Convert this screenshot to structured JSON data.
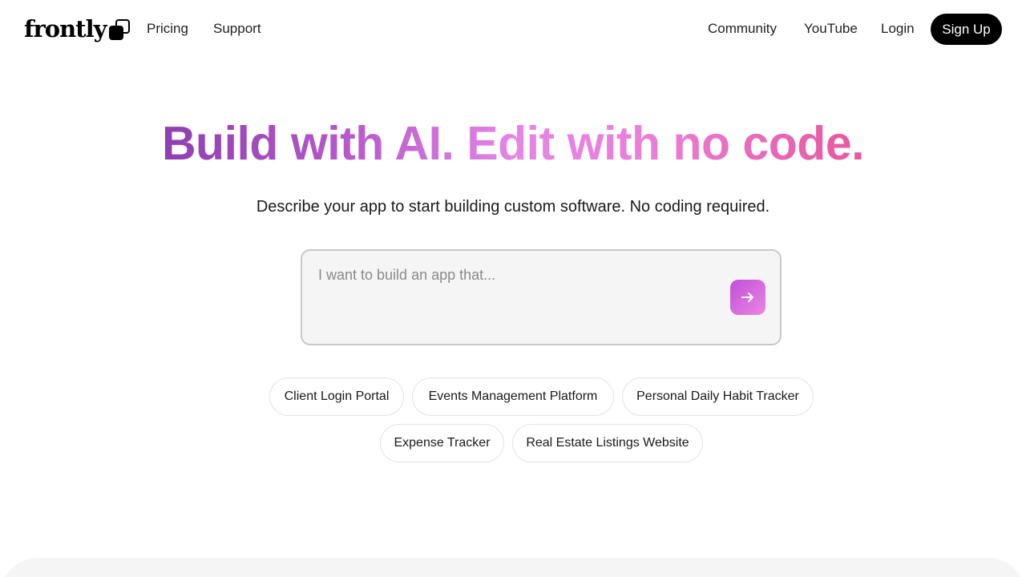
{
  "brand": {
    "name": "frontly",
    "icon": "overlapping-squares-logo"
  },
  "nav": {
    "left_links": [
      "Pricing",
      "Support"
    ],
    "right_links": [
      "Community",
      "YouTube",
      "Login"
    ],
    "signup_label": "Sign Up"
  },
  "hero": {
    "headline": "Build with AI. Edit with no code.",
    "subhead": "Describe your app to start building custom software. No coding required."
  },
  "prompt": {
    "placeholder": "I want to build an app that...",
    "value": "",
    "submit_icon": "arrow-right-icon"
  },
  "suggestions": [
    "Client Login Portal",
    "Events Management Platform",
    "Personal Daily Habit Tracker",
    "Expense Tracker",
    "Real Estate Listings Website"
  ],
  "colors": {
    "gradient_start": "#8e3fb2",
    "gradient_mid": "#e585e6",
    "gradient_end": "#e8569e",
    "button_dark": "#000000",
    "panel_bg": "#f5f5f5"
  }
}
